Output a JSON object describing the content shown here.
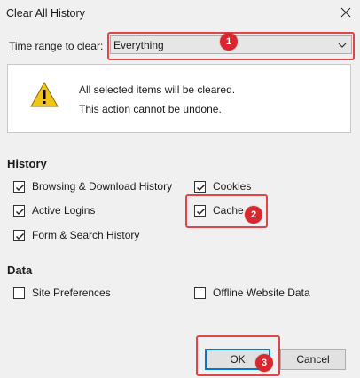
{
  "window": {
    "title": "Clear All History"
  },
  "time_range": {
    "label_prefix": "T",
    "label_rest": "ime range to clear:",
    "selected": "Everything"
  },
  "message": {
    "line1": "All selected items will be cleared.",
    "line2": "This action cannot be undone."
  },
  "history": {
    "heading": "History",
    "items": [
      {
        "label": "Browsing & Download History",
        "checked": true
      },
      {
        "label": "Active Logins",
        "checked": true
      },
      {
        "label": "Form & Search History",
        "checked": true
      },
      {
        "label": "Cookies",
        "checked": true
      },
      {
        "label": "Cache",
        "checked": true
      }
    ]
  },
  "data": {
    "heading": "Data",
    "items": [
      {
        "label": "Site Preferences",
        "checked": false
      },
      {
        "label": "Offline Website Data",
        "checked": false
      }
    ]
  },
  "buttons": {
    "ok": "OK",
    "cancel": "Cancel"
  },
  "annotations": {
    "badge1": "1",
    "badge2": "2",
    "badge3": "3",
    "color": "#e0454a"
  }
}
